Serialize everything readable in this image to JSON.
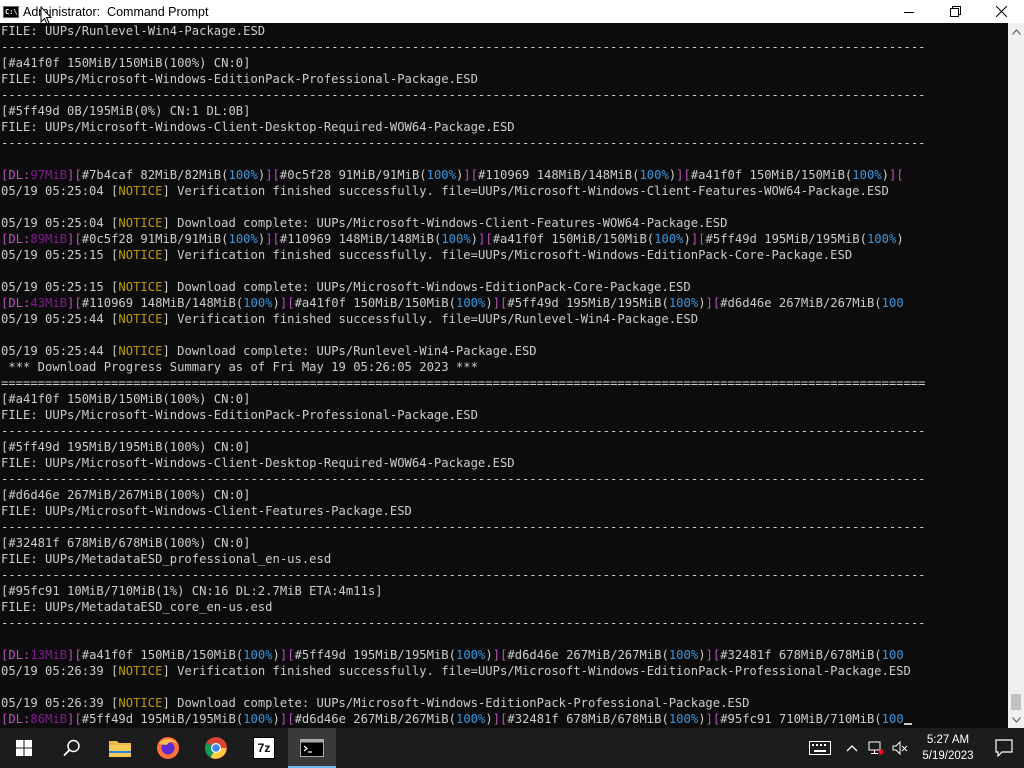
{
  "window": {
    "title": "Administrator:  Command Prompt",
    "icon_label": "C:\\",
    "icon": "cmd-icon",
    "controls": [
      "minimize-icon",
      "maximize-icon",
      "close-icon"
    ]
  },
  "colors": {
    "console_bg": "#0c0c0c",
    "console_text": "#cccccc",
    "dl_label": "#881798",
    "percent": "#3a96dd",
    "notice": "#c19c00",
    "taskbar_bg": "#1c1c1c",
    "active_task_underline": "#76b9ed"
  },
  "console": {
    "lines": [
      [
        {
          "t": "FILE: UUPs/Runlevel-Win4-Package.ESD"
        }
      ],
      [
        {
          "t": "------------------------------------------------------------------------------------------------------------------------------"
        }
      ],
      [
        {
          "t": "[#a41f0f 150MiB/150MiB(100%) CN:0]"
        }
      ],
      [
        {
          "t": "FILE: UUPs/Microsoft-Windows-EditionPack-Professional-Package.ESD"
        }
      ],
      [
        {
          "t": "------------------------------------------------------------------------------------------------------------------------------"
        }
      ],
      [
        {
          "t": "[#5ff49d 0B/195MiB(0%) CN:1 DL:0B]"
        }
      ],
      [
        {
          "t": "FILE: UUPs/Microsoft-Windows-Client-Desktop-Required-WOW64-Package.ESD"
        }
      ],
      [
        {
          "t": "------------------------------------------------------------------------------------------------------------------------------"
        }
      ],
      [
        {
          "t": ""
        }
      ],
      [
        {
          "t": "[",
          "c": "pk"
        },
        {
          "t": "DL:",
          "c": "pk"
        },
        {
          "t": "97MiB",
          "c": "p"
        },
        {
          "t": "]",
          "c": "pk"
        },
        {
          "t": "[",
          "c": "pk"
        },
        {
          "t": "#7b4caf 82MiB/82MiB("
        },
        {
          "t": "100%",
          "c": "g"
        },
        {
          "t": ")"
        },
        {
          "t": "][",
          "c": "pk"
        },
        {
          "t": "#0c5f28 91MiB/91MiB("
        },
        {
          "t": "100%",
          "c": "g"
        },
        {
          "t": ")"
        },
        {
          "t": "][",
          "c": "pk"
        },
        {
          "t": "#110969 148MiB/148MiB("
        },
        {
          "t": "100%",
          "c": "g"
        },
        {
          "t": ")"
        },
        {
          "t": "][",
          "c": "pk"
        },
        {
          "t": "#a41f0f 150MiB/150MiB("
        },
        {
          "t": "100%",
          "c": "g"
        },
        {
          "t": ")"
        },
        {
          "t": "][",
          "c": "pk"
        }
      ],
      [
        {
          "t": "05/19 05:25:04 ["
        },
        {
          "t": "NOTICE",
          "c": "y"
        },
        {
          "t": "] Verification finished successfully. file=UUPs/Microsoft-Windows-Client-Features-WOW64-Package.ESD"
        }
      ],
      [
        {
          "t": ""
        }
      ],
      [
        {
          "t": "05/19 05:25:04 ["
        },
        {
          "t": "NOTICE",
          "c": "y"
        },
        {
          "t": "] Download complete: UUPs/Microsoft-Windows-Client-Features-WOW64-Package.ESD"
        }
      ],
      [
        {
          "t": "[",
          "c": "pk"
        },
        {
          "t": "DL:",
          "c": "pk"
        },
        {
          "t": "89MiB",
          "c": "p"
        },
        {
          "t": "]",
          "c": "pk"
        },
        {
          "t": "[",
          "c": "pk"
        },
        {
          "t": "#0c5f28 91MiB/91MiB("
        },
        {
          "t": "100%",
          "c": "g"
        },
        {
          "t": ")"
        },
        {
          "t": "][",
          "c": "pk"
        },
        {
          "t": "#110969 148MiB/148MiB("
        },
        {
          "t": "100%",
          "c": "g"
        },
        {
          "t": ")"
        },
        {
          "t": "][",
          "c": "pk"
        },
        {
          "t": "#a41f0f 150MiB/150MiB("
        },
        {
          "t": "100%",
          "c": "g"
        },
        {
          "t": ")"
        },
        {
          "t": "][",
          "c": "pk"
        },
        {
          "t": "#5ff49d 195MiB/195MiB("
        },
        {
          "t": "100%",
          "c": "g"
        },
        {
          "t": ")"
        }
      ],
      [
        {
          "t": "05/19 05:25:15 ["
        },
        {
          "t": "NOTICE",
          "c": "y"
        },
        {
          "t": "] Verification finished successfully. file=UUPs/Microsoft-Windows-EditionPack-Core-Package.ESD"
        }
      ],
      [
        {
          "t": ""
        }
      ],
      [
        {
          "t": "05/19 05:25:15 ["
        },
        {
          "t": "NOTICE",
          "c": "y"
        },
        {
          "t": "] Download complete: UUPs/Microsoft-Windows-EditionPack-Core-Package.ESD"
        }
      ],
      [
        {
          "t": "[",
          "c": "pk"
        },
        {
          "t": "DL:",
          "c": "pk"
        },
        {
          "t": "43MiB",
          "c": "p"
        },
        {
          "t": "]",
          "c": "pk"
        },
        {
          "t": "[",
          "c": "pk"
        },
        {
          "t": "#110969 148MiB/148MiB("
        },
        {
          "t": "100%",
          "c": "g"
        },
        {
          "t": ")"
        },
        {
          "t": "][",
          "c": "pk"
        },
        {
          "t": "#a41f0f 150MiB/150MiB("
        },
        {
          "t": "100%",
          "c": "g"
        },
        {
          "t": ")"
        },
        {
          "t": "][",
          "c": "pk"
        },
        {
          "t": "#5ff49d 195MiB/195MiB("
        },
        {
          "t": "100%",
          "c": "g"
        },
        {
          "t": ")"
        },
        {
          "t": "][",
          "c": "pk"
        },
        {
          "t": "#d6d46e 267MiB/267MiB("
        },
        {
          "t": "100",
          "c": "g"
        }
      ],
      [
        {
          "t": "05/19 05:25:44 ["
        },
        {
          "t": "NOTICE",
          "c": "y"
        },
        {
          "t": "] Verification finished successfully. file=UUPs/Runlevel-Win4-Package.ESD"
        }
      ],
      [
        {
          "t": ""
        }
      ],
      [
        {
          "t": "05/19 05:25:44 ["
        },
        {
          "t": "NOTICE",
          "c": "y"
        },
        {
          "t": "] Download complete: UUPs/Runlevel-Win4-Package.ESD"
        }
      ],
      [
        {
          "t": " *** Download Progress Summary as of Fri May 19 05:26:05 2023 ***"
        }
      ],
      [
        {
          "t": "=============================================================================================================================="
        }
      ],
      [
        {
          "t": "[#a41f0f 150MiB/150MiB(100%) CN:0]"
        }
      ],
      [
        {
          "t": "FILE: UUPs/Microsoft-Windows-EditionPack-Professional-Package.ESD"
        }
      ],
      [
        {
          "t": "------------------------------------------------------------------------------------------------------------------------------"
        }
      ],
      [
        {
          "t": "[#5ff49d 195MiB/195MiB(100%) CN:0]"
        }
      ],
      [
        {
          "t": "FILE: UUPs/Microsoft-Windows-Client-Desktop-Required-WOW64-Package.ESD"
        }
      ],
      [
        {
          "t": "------------------------------------------------------------------------------------------------------------------------------"
        }
      ],
      [
        {
          "t": "[#d6d46e 267MiB/267MiB(100%) CN:0]"
        }
      ],
      [
        {
          "t": "FILE: UUPs/Microsoft-Windows-Client-Features-Package.ESD"
        }
      ],
      [
        {
          "t": "------------------------------------------------------------------------------------------------------------------------------"
        }
      ],
      [
        {
          "t": "[#32481f 678MiB/678MiB(100%) CN:0]"
        }
      ],
      [
        {
          "t": "FILE: UUPs/MetadataESD_professional_en-us.esd"
        }
      ],
      [
        {
          "t": "------------------------------------------------------------------------------------------------------------------------------"
        }
      ],
      [
        {
          "t": "[#95fc91 10MiB/710MiB(1%) CN:16 DL:2.7MiB ETA:4m11s]"
        }
      ],
      [
        {
          "t": "FILE: UUPs/MetadataESD_core_en-us.esd"
        }
      ],
      [
        {
          "t": "------------------------------------------------------------------------------------------------------------------------------"
        }
      ],
      [
        {
          "t": ""
        }
      ],
      [
        {
          "t": "[",
          "c": "pk"
        },
        {
          "t": "DL:",
          "c": "pk"
        },
        {
          "t": "13MiB",
          "c": "p"
        },
        {
          "t": "]",
          "c": "pk"
        },
        {
          "t": "[",
          "c": "pk"
        },
        {
          "t": "#a41f0f 150MiB/150MiB("
        },
        {
          "t": "100%",
          "c": "g"
        },
        {
          "t": ")"
        },
        {
          "t": "][",
          "c": "pk"
        },
        {
          "t": "#5ff49d 195MiB/195MiB("
        },
        {
          "t": "100%",
          "c": "g"
        },
        {
          "t": ")"
        },
        {
          "t": "][",
          "c": "pk"
        },
        {
          "t": "#d6d46e 267MiB/267MiB("
        },
        {
          "t": "100%",
          "c": "g"
        },
        {
          "t": ")"
        },
        {
          "t": "][",
          "c": "pk"
        },
        {
          "t": "#32481f 678MiB/678MiB("
        },
        {
          "t": "100",
          "c": "g"
        }
      ],
      [
        {
          "t": "05/19 05:26:39 ["
        },
        {
          "t": "NOTICE",
          "c": "y"
        },
        {
          "t": "] Verification finished successfully. file=UUPs/Microsoft-Windows-EditionPack-Professional-Package.ESD"
        }
      ],
      [
        {
          "t": ""
        }
      ],
      [
        {
          "t": "05/19 05:26:39 ["
        },
        {
          "t": "NOTICE",
          "c": "y"
        },
        {
          "t": "] Download complete: UUPs/Microsoft-Windows-EditionPack-Professional-Package.ESD"
        }
      ],
      [
        {
          "t": "[",
          "c": "pk"
        },
        {
          "t": "DL:",
          "c": "pk"
        },
        {
          "t": "86MiB",
          "c": "p"
        },
        {
          "t": "]",
          "c": "pk"
        },
        {
          "t": "[",
          "c": "pk"
        },
        {
          "t": "#5ff49d 195MiB/195MiB("
        },
        {
          "t": "100%",
          "c": "g"
        },
        {
          "t": ")"
        },
        {
          "t": "][",
          "c": "pk"
        },
        {
          "t": "#d6d46e 267MiB/267MiB("
        },
        {
          "t": "100%",
          "c": "g"
        },
        {
          "t": ")"
        },
        {
          "t": "][",
          "c": "pk"
        },
        {
          "t": "#32481f 678MiB/678MiB("
        },
        {
          "t": "100%",
          "c": "g"
        },
        {
          "t": ")"
        },
        {
          "t": "][",
          "c": "pk"
        },
        {
          "t": "#95fc91 710MiB/710MiB("
        },
        {
          "t": "100",
          "c": "g"
        }
      ]
    ]
  },
  "taskbar": {
    "items": [
      {
        "name": "start-button",
        "icon": "windows-logo-icon"
      },
      {
        "name": "search-button",
        "icon": "search-icon"
      },
      {
        "name": "file-explorer-button",
        "icon": "folder-icon"
      },
      {
        "name": "firefox-button",
        "icon": "firefox-icon"
      },
      {
        "name": "chrome-button",
        "icon": "chrome-icon"
      },
      {
        "name": "7zip-button",
        "icon": "7zip-icon",
        "label": "7z"
      },
      {
        "name": "command-prompt-button",
        "icon": "cmd-icon",
        "active": true
      }
    ],
    "tray": {
      "icons": [
        "keyboard-icon",
        "chevron-up-icon",
        "network-icon",
        "volume-muted-icon"
      ],
      "time": "5:27 AM",
      "date": "5/19/2023"
    }
  }
}
